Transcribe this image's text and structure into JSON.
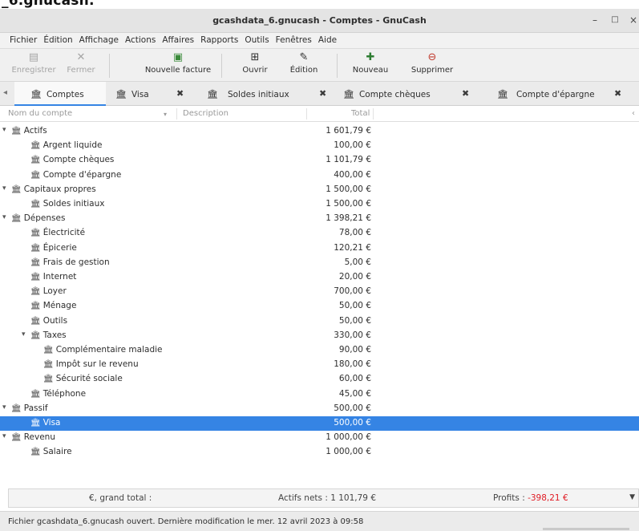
{
  "top_caption": "_6.gnucash:",
  "window": {
    "title": "gcashdata_6.gnucash - Comptes - GnuCash",
    "minimize_glyph": "–",
    "maximize_glyph": "□",
    "close_glyph": "×"
  },
  "menu": [
    "Fichier",
    "Édition",
    "Affichage",
    "Actions",
    "Affaires",
    "Rapports",
    "Outils",
    "Fenêtres",
    "Aide"
  ],
  "toolbar": {
    "save": {
      "label": "Enregistrer",
      "icon": "save-icon",
      "enabled": false
    },
    "close": {
      "label": "Fermer",
      "icon": "close-icon",
      "enabled": false
    },
    "new_invoice": {
      "label": "Nouvelle facture",
      "icon": "new-invoice-icon",
      "enabled": true
    },
    "open": {
      "label": "Ouvrir",
      "icon": "open-icon",
      "enabled": true
    },
    "edit": {
      "label": "Édition",
      "icon": "edit-icon",
      "enabled": true
    },
    "new": {
      "label": "Nouveau",
      "icon": "new-account-icon",
      "enabled": true
    },
    "delete": {
      "label": "Supprimer",
      "icon": "delete-icon",
      "enabled": true
    }
  },
  "tabs": [
    {
      "label": "Comptes",
      "active": true
    },
    {
      "label": "Visa",
      "active": false
    },
    {
      "label": "Soldes initiaux",
      "active": false
    },
    {
      "label": "Compte chèques",
      "active": false
    },
    {
      "label": "Compte d'épargne",
      "active": false
    }
  ],
  "columns": {
    "name": "Nom du compte",
    "description": "Description",
    "total": "Total"
  },
  "accounts": [
    {
      "name": "Actifs",
      "total": "1 601,79 €",
      "level": 0,
      "expander": "▾"
    },
    {
      "name": "Argent liquide",
      "total": "100,00 €",
      "level": 1
    },
    {
      "name": "Compte chèques",
      "total": "1 101,79 €",
      "level": 1
    },
    {
      "name": "Compte d'épargne",
      "total": "400,00 €",
      "level": 1
    },
    {
      "name": "Capitaux propres",
      "total": "1 500,00 €",
      "level": 0,
      "expander": "▾"
    },
    {
      "name": "Soldes initiaux",
      "total": "1 500,00 €",
      "level": 1
    },
    {
      "name": "Dépenses",
      "total": "1 398,21 €",
      "level": 0,
      "expander": "▾"
    },
    {
      "name": "Électricité",
      "total": "78,00 €",
      "level": 1
    },
    {
      "name": "Épicerie",
      "total": "120,21 €",
      "level": 1
    },
    {
      "name": "Frais de gestion",
      "total": "5,00 €",
      "level": 1
    },
    {
      "name": "Internet",
      "total": "20,00 €",
      "level": 1
    },
    {
      "name": "Loyer",
      "total": "700,00 €",
      "level": 1
    },
    {
      "name": "Ménage",
      "total": "50,00 €",
      "level": 1
    },
    {
      "name": "Outils",
      "total": "50,00 €",
      "level": 1
    },
    {
      "name": "Taxes",
      "total": "330,00 €",
      "level": 1,
      "expander": "▾"
    },
    {
      "name": "Complémentaire maladie",
      "total": "90,00 €",
      "level": 2
    },
    {
      "name": "Impôt sur le revenu",
      "total": "180,00 €",
      "level": 2
    },
    {
      "name": "Sécurité sociale",
      "total": "60,00 €",
      "level": 2
    },
    {
      "name": "Téléphone",
      "total": "45,00 €",
      "level": 1
    },
    {
      "name": "Passif",
      "total": "500,00 €",
      "level": 0,
      "expander": "▾"
    },
    {
      "name": "Visa",
      "total": "500,00 €",
      "level": 1,
      "selected": true
    },
    {
      "name": "Revenu",
      "total": "1 000,00 €",
      "level": 0,
      "expander": "▾"
    },
    {
      "name": "Salaire",
      "total": "1 000,00 €",
      "level": 1
    }
  ],
  "summary": {
    "grand_total": "€, grand total :",
    "net_assets": "Actifs nets : 1 101,79 €",
    "profits_label": "Profits : ",
    "profits_value": "-398,21 €"
  },
  "status": "Fichier gcashdata_6.gnucash ouvert. Dernière modification le mer. 12 avril 2023 à 09:58",
  "colors": {
    "accent": "#3584e4",
    "negative": "#e01b24"
  }
}
